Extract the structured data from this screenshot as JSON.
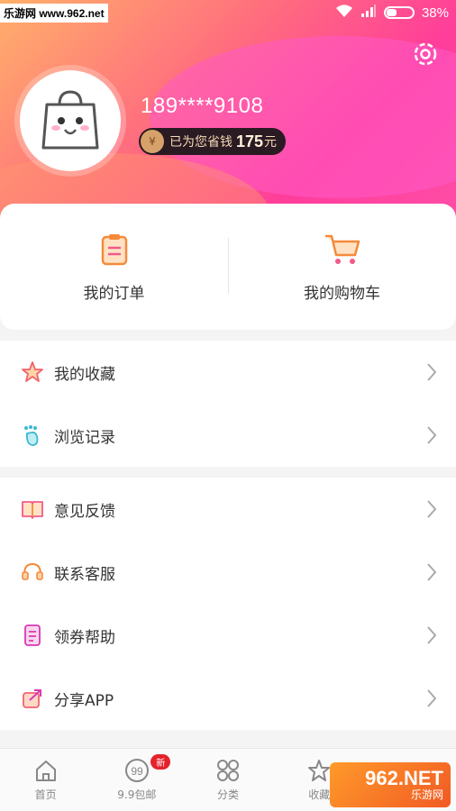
{
  "status": {
    "watermark": "乐游网 www.962.net",
    "battery": "38%"
  },
  "profile": {
    "phone": "189****9108",
    "saved_label": "已为您省钱",
    "saved_amount": "175",
    "saved_unit": "元"
  },
  "quick": {
    "orders": "我的订单",
    "cart": "我的购物车"
  },
  "menu_group1": [
    {
      "label": "我的收藏",
      "icon": "star-icon"
    },
    {
      "label": "浏览记录",
      "icon": "footprint-icon"
    }
  ],
  "menu_group2": [
    {
      "label": "意见反馈",
      "icon": "feedback-book-icon"
    },
    {
      "label": "联系客服",
      "icon": "headset-icon"
    },
    {
      "label": "领券帮助",
      "icon": "coupon-help-icon"
    },
    {
      "label": "分享APP",
      "icon": "share-icon"
    }
  ],
  "tabbar": {
    "home": "首页",
    "deals": "9.9包邮",
    "deals_badge": "新",
    "category": "分类",
    "favorites": "收藏"
  },
  "watermark_bottom": {
    "big": "962.NET",
    "small": "乐游网"
  },
  "colors": {
    "accent": "#ff4fa8",
    "gradient_start": "#ffb06a",
    "badge": "#e5222c"
  }
}
